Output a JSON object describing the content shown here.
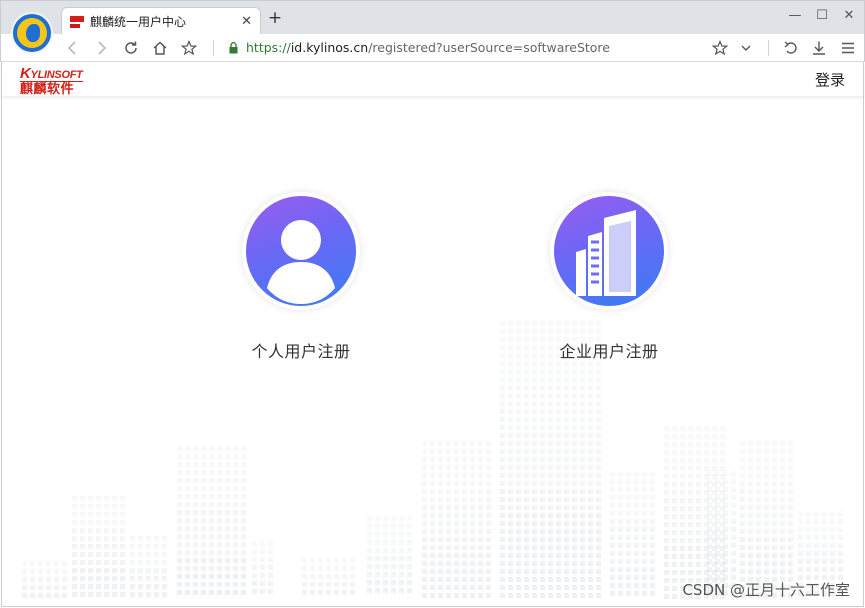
{
  "browser": {
    "tab_title": "麒麟统一用户中心",
    "tab_close": "✕",
    "new_tab": "+",
    "url_scheme": "https://",
    "url_host": "id.kylinos.cn",
    "url_path": "/registered?userSource=softwareStore",
    "window_controls": {
      "minimize": "—",
      "maximize": "☐",
      "close": "✕"
    }
  },
  "header": {
    "logo_en_first": "K",
    "logo_en_rest": "YLINSOFT",
    "logo_cn": "麒麟软件",
    "login_label": "登录"
  },
  "main": {
    "cards": [
      {
        "label": "个人用户注册",
        "icon": "user-avatar-icon"
      },
      {
        "label": "企业用户注册",
        "icon": "office-building-icon"
      }
    ]
  },
  "watermark": "CSDN @正月十六工作室",
  "colors": {
    "brand_red": "#d2201a",
    "icon_gradient_start": "#9a5cf0",
    "icon_gradient_end": "#3a7df4",
    "secure_green": "#2e7d32"
  }
}
